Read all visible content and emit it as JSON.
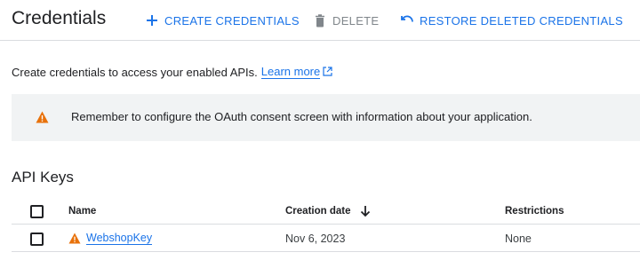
{
  "header": {
    "title": "Credentials",
    "actions": {
      "create": "CREATE CREDENTIALS",
      "delete": "DELETE",
      "restore": "RESTORE DELETED CREDENTIALS"
    }
  },
  "intro": {
    "text": "Create credentials to access your enabled APIs.",
    "link": "Learn more"
  },
  "banner": {
    "text": "Remember to configure the OAuth consent screen with information about your application."
  },
  "api_keys": {
    "title": "API Keys",
    "columns": {
      "name": "Name",
      "creation_date": "Creation date",
      "restrictions": "Restrictions"
    },
    "rows": [
      {
        "name": "WebshopKey",
        "creation_date": "Nov 6, 2023",
        "restrictions": "None"
      }
    ]
  },
  "icons": {
    "create": "plus-icon",
    "delete": "trash-icon",
    "restore": "restore-icon",
    "external": "external-link-icon",
    "warning": "warning-icon",
    "sort": "arrow-down-icon"
  },
  "colors": {
    "accent": "#1a73e8",
    "warning": "#e8710a",
    "disabled": "#80868b",
    "banner_bg": "#f1f3f4"
  }
}
